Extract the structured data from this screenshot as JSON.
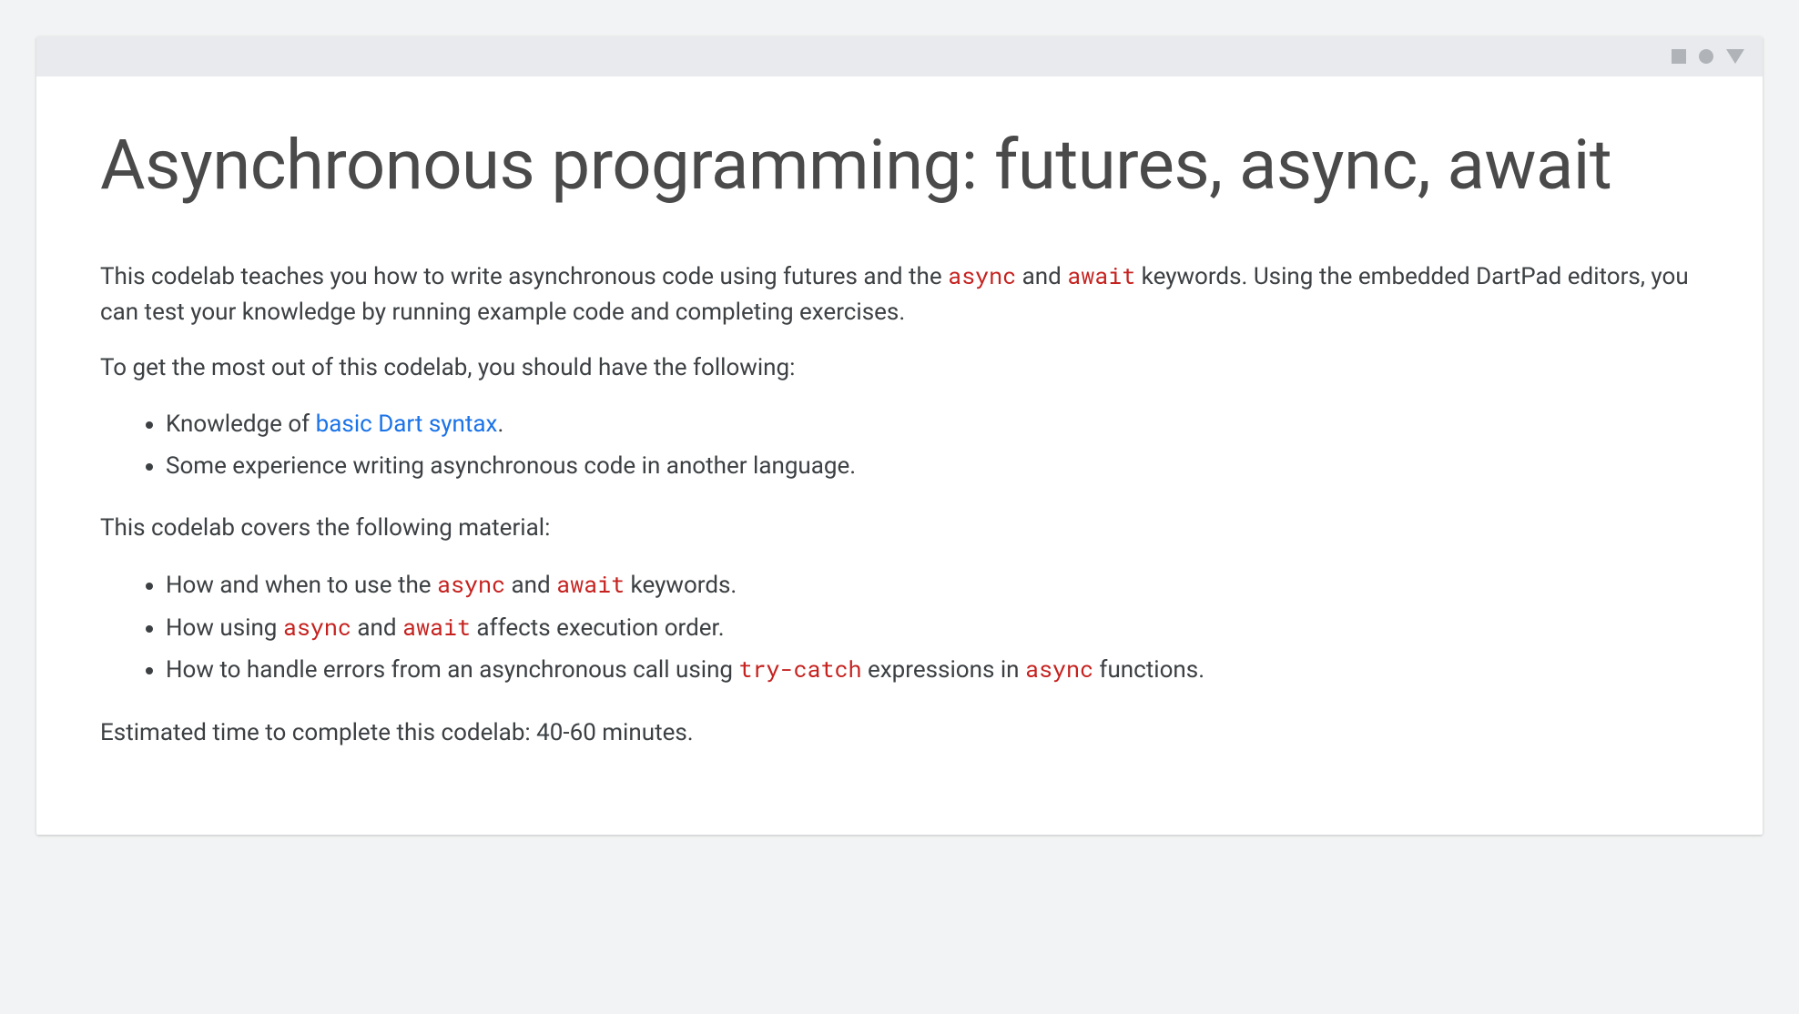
{
  "title": "Asynchronous programming: futures, async, await",
  "intro": {
    "p1_prefix": "This codelab teaches you how to write asynchronous code using futures and the ",
    "code1": "async",
    "p1_mid": " and ",
    "code2": "await",
    "p1_suffix": " keywords. Using the embedded DartPad editors, you can test your knowledge by running example code and completing exercises."
  },
  "prereq_intro": "To get the most out of this codelab, you should have the following:",
  "prereqs": {
    "item1_prefix": "Knowledge of ",
    "item1_link": "basic Dart syntax",
    "item1_suffix": ".",
    "item2": "Some experience writing asynchronous code in another language."
  },
  "covers_intro": "This codelab covers the following material:",
  "covers": {
    "item1_prefix": "How and when to use the ",
    "item1_code1": "async",
    "item1_mid": " and ",
    "item1_code2": "await",
    "item1_suffix": " keywords.",
    "item2_prefix": "How using ",
    "item2_code1": "async",
    "item2_mid": " and ",
    "item2_code2": "await",
    "item2_suffix": " affects execution order.",
    "item3_prefix": "How to handle errors from an asynchronous call using ",
    "item3_code1": "try-catch",
    "item3_mid": " expressions in ",
    "item3_code2": "async",
    "item3_suffix": " functions."
  },
  "estimated_time": "Estimated time to complete this codelab: 40-60 minutes."
}
